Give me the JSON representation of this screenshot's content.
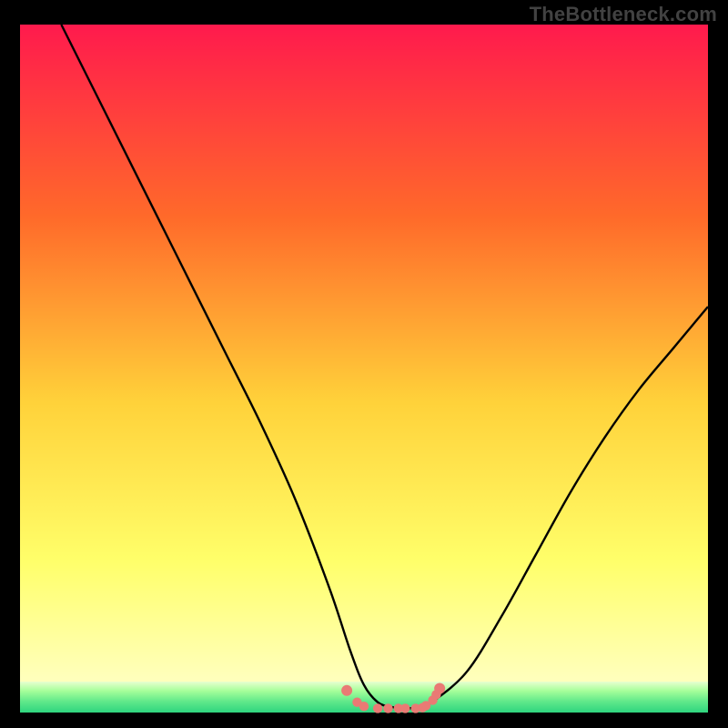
{
  "watermark": "TheBottleneck.com",
  "colors": {
    "bg": "#000000",
    "grad_top": "#ff1a4d",
    "grad_mid1": "#ff6a2a",
    "grad_mid2": "#ffd23a",
    "grad_mid3": "#ffff6a",
    "grad_bottom_yellow": "#ffffbb",
    "green_light": "#a6ff9a",
    "green_mid": "#5fe88a",
    "green_dark": "#2fd57f",
    "curve": "#000000",
    "marker": "#e97a74"
  },
  "layout": {
    "frame_left": 22,
    "frame_top": 27,
    "frame_size": 756,
    "green_top_frac": 0.955,
    "green_height_frac": 0.045
  },
  "chart_data": {
    "type": "line",
    "title": "",
    "xlabel": "",
    "ylabel": "",
    "xlim": [
      0,
      100
    ],
    "ylim": [
      0,
      100
    ],
    "series": [
      {
        "name": "bottleneck-curve",
        "x": [
          6,
          10,
          15,
          20,
          25,
          30,
          35,
          40,
          45,
          48,
          50,
          52,
          54,
          56,
          58,
          60,
          65,
          70,
          75,
          80,
          85,
          90,
          95,
          100
        ],
        "y": [
          100,
          92,
          82,
          72,
          62,
          52,
          42,
          31,
          18,
          9,
          4,
          1.5,
          0.8,
          0.6,
          0.8,
          1.6,
          6,
          14,
          23,
          32,
          40,
          47,
          53,
          59
        ]
      }
    ],
    "markers": {
      "name": "flat-bottom-dots",
      "x": [
        47.5,
        49,
        50,
        52,
        53.5,
        55,
        56,
        57.5,
        58.5,
        59,
        60,
        60.5,
        61
      ],
      "y": [
        3.2,
        1.5,
        0.9,
        0.6,
        0.6,
        0.6,
        0.6,
        0.6,
        0.7,
        1.0,
        1.8,
        2.6,
        3.5
      ]
    },
    "annotations": []
  }
}
